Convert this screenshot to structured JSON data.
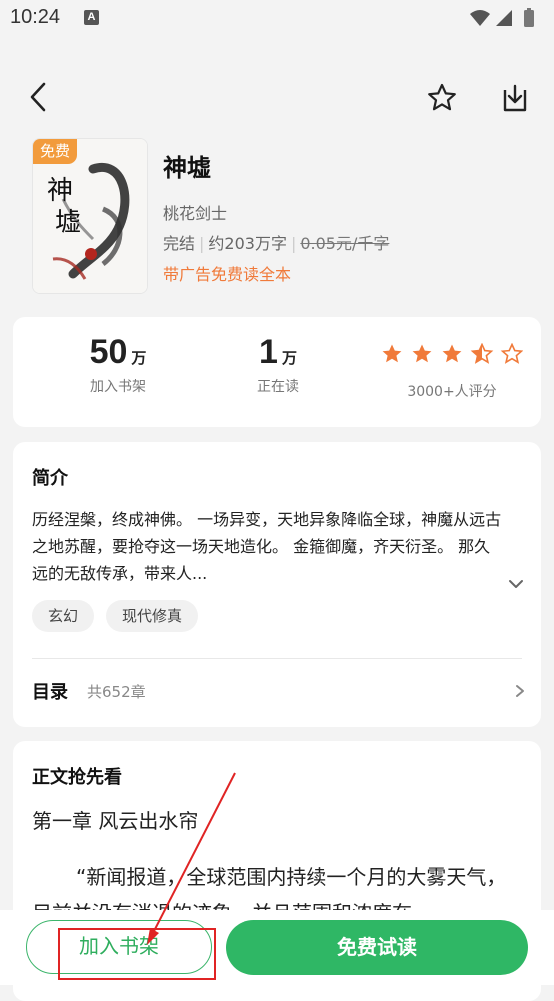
{
  "status_bar": {
    "time": "10:24",
    "notification_letter": "A"
  },
  "book": {
    "cover_badge": "免费",
    "title": "神墟",
    "author": "桃花剑士",
    "status": "完结",
    "word_count": "约203万字",
    "price": "0.05元/千字",
    "promo": "带广告免费读全本"
  },
  "stats": {
    "shelf_count": "50",
    "shelf_unit": "万",
    "shelf_label": "加入书架",
    "reading_count": "1",
    "reading_unit": "万",
    "reading_label": "正在读",
    "rating_stars": 3.5,
    "rating_label": "3000+人评分"
  },
  "intro": {
    "title": "简介",
    "text": "历经涅槃，终成神佛。 一场异变，天地异象降临全球，神魔从远古之地苏醒，要抢夺这一场天地造化。 金箍御魔，齐天衍圣。 那久远的无敌传承，带来人...",
    "tags": [
      "玄幻",
      "现代修真"
    ]
  },
  "toc": {
    "label": "目录",
    "count": "共652章"
  },
  "preview": {
    "title": "正文抢先看",
    "chapter_title": "第一章 风云出水帘",
    "text": "“新闻报道，全球范围内持续一个月的大雾天气，目前并没有消退的迹象，并且范围和浓度在"
  },
  "actions": {
    "add_shelf": "加入书架",
    "free_read": "免费试读"
  },
  "colors": {
    "accent_green": "#2fb765",
    "accent_orange": "#f07a3a",
    "annotation_red": "#e02424"
  },
  "icons": [
    "back-arrow-icon",
    "star-icon",
    "download-icon",
    "chevron-down-icon",
    "chevron-right-icon"
  ]
}
